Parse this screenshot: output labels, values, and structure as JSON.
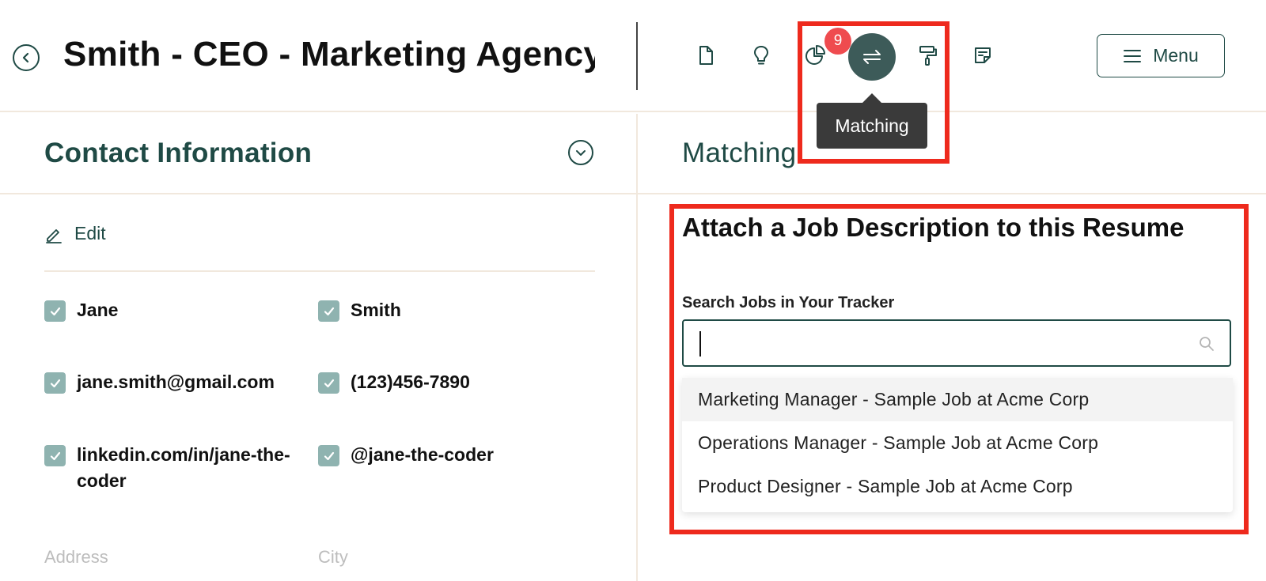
{
  "header": {
    "title": "Smith - CEO - Marketing Agency",
    "badge_count": "9",
    "tooltip": "Matching",
    "menu_label": "Menu",
    "tools": [
      "document-icon",
      "lightbulb-icon",
      "pie-chart-icon",
      "matching-arrows-icon",
      "paint-roller-icon",
      "sticky-note-icon"
    ]
  },
  "contact": {
    "section_title": "Contact Information",
    "edit_label": "Edit",
    "fields": {
      "first_name": "Jane",
      "last_name": "Smith",
      "email": "jane.smith@gmail.com",
      "phone": "(123)456-7890",
      "linkedin": "linkedin.com/in/jane-the-coder",
      "handle": "@jane-the-coder"
    },
    "placeholders": {
      "address": "Address",
      "city": "City"
    }
  },
  "matching": {
    "section_title": "Matching",
    "attach_title": "Attach a Job Description to this Resume",
    "search_label": "Search Jobs in Your Tracker",
    "search_value": "",
    "options": [
      "Marketing Manager - Sample Job at Acme Corp",
      "Operations Manager - Sample Job at Acme Corp",
      "Product Designer - Sample Job at Acme Corp"
    ]
  },
  "colors": {
    "brand": "#1f4a45",
    "active_tool": "#3d5b59",
    "badge": "#ef4b4f",
    "highlight": "#ee2a1d",
    "checkbox": "#8fb3b0"
  }
}
